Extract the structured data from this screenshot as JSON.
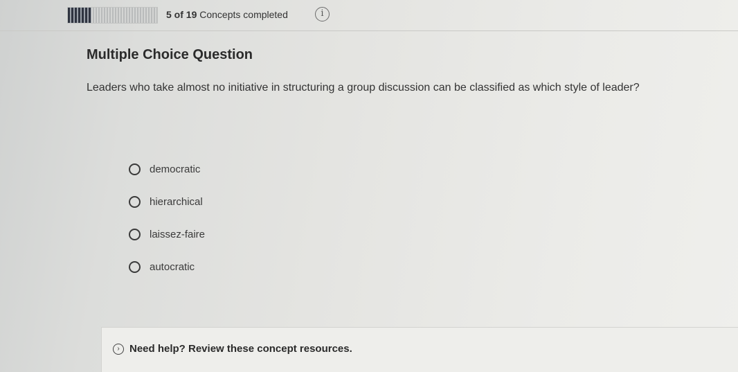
{
  "header": {
    "progress": {
      "completed": 5,
      "total": 19,
      "fill_fraction": 0.263,
      "count_text": "5 of 19",
      "suffix_text": "Concepts completed"
    },
    "info_icon": "info-icon"
  },
  "question": {
    "type_label": "Multiple Choice Question",
    "text": "Leaders who take almost no initiative in structuring a group discussion can be classified as which style of leader?",
    "options": [
      {
        "label": "democratic"
      },
      {
        "label": "hierarchical"
      },
      {
        "label": "laissez-faire"
      },
      {
        "label": "autocratic"
      }
    ]
  },
  "help": {
    "icon": "chevron-right-icon",
    "label": "Need help? Review these concept resources."
  }
}
